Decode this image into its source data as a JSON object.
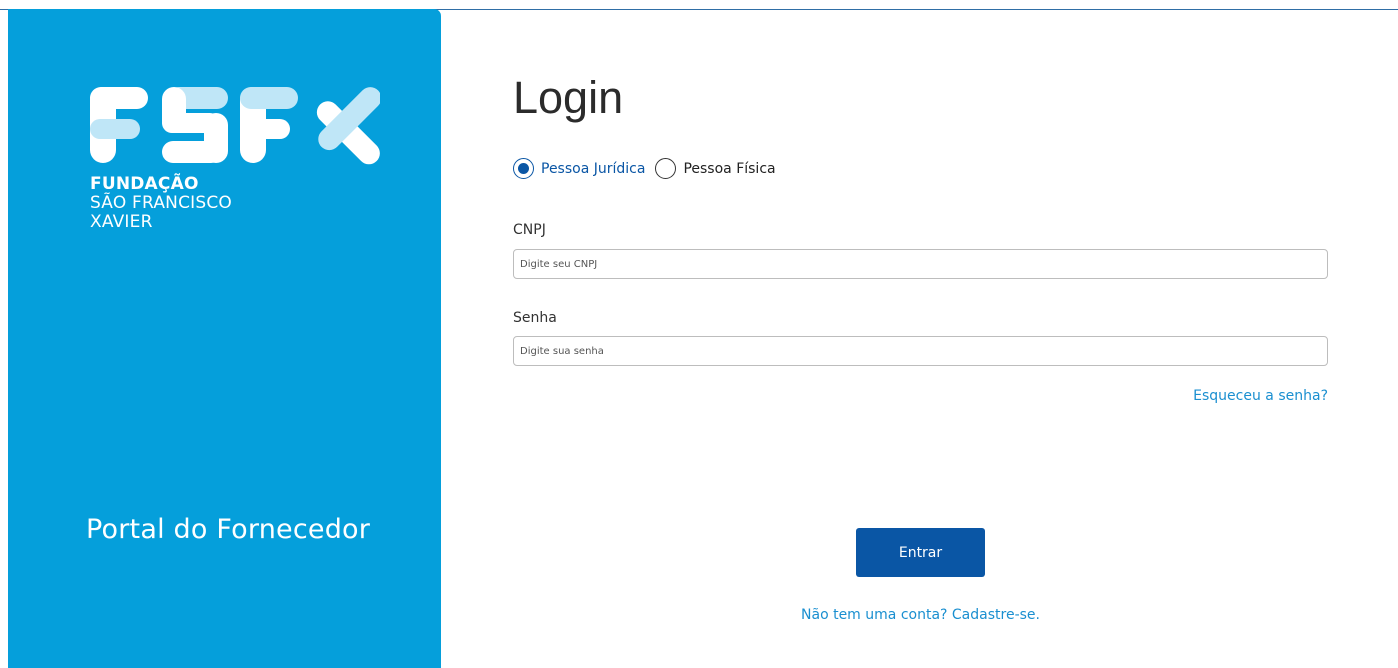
{
  "brand": {
    "logo_mark": "FSFX",
    "logo_lines": [
      "FUNDAÇÃO",
      "SÃO FRANCISCO",
      "XAVIER"
    ],
    "portal_title": "Portal do Fornecedor",
    "panel_color": "#059fdb"
  },
  "login": {
    "title": "Login",
    "person_types": [
      {
        "label": "Pessoa Jurídica",
        "selected": true
      },
      {
        "label": "Pessoa Física",
        "selected": false
      }
    ],
    "cnpj": {
      "label": "CNPJ",
      "placeholder": "Digite seu CNPJ",
      "value": ""
    },
    "password": {
      "label": "Senha",
      "placeholder": "Digite sua senha",
      "value": ""
    },
    "forgot_password": "Esqueceu a senha?",
    "submit_label": "Entrar",
    "signup_text": "Não tem uma conta? Cadastre-se."
  },
  "colors": {
    "primary": "#0a56a5",
    "link": "#1a8fd0",
    "brand_blue": "#059fdb"
  }
}
